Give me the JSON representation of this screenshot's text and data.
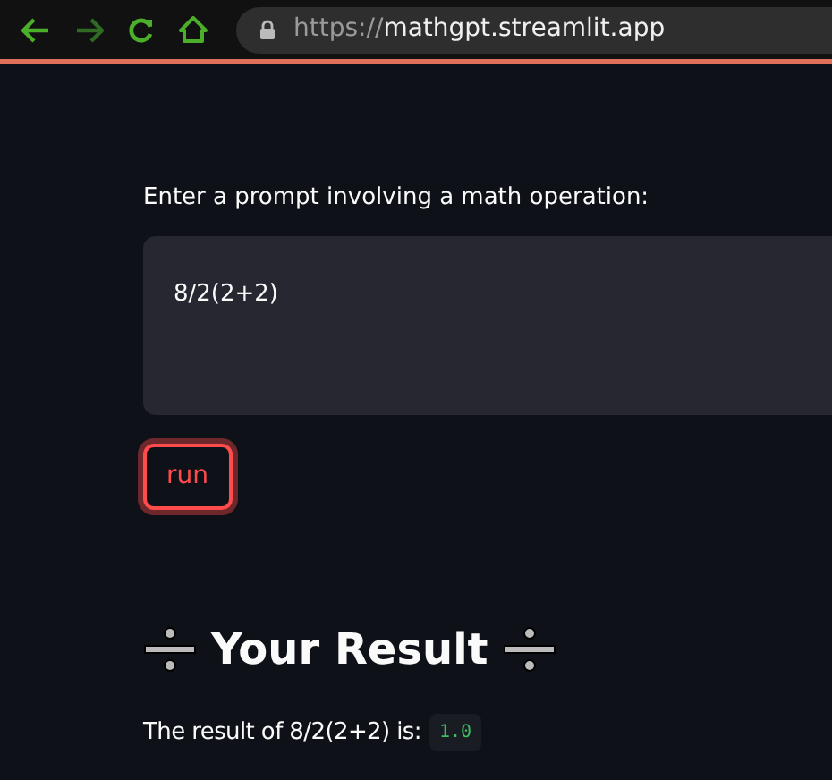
{
  "browser": {
    "url_scheme": "https://",
    "url_host": "mathgpt.streamlit.app"
  },
  "prompt": {
    "label": "Enter a prompt involving a math operation:",
    "value": "8/2(2+2)"
  },
  "run_button": {
    "label": "run",
    "focused": true
  },
  "result": {
    "heading": "Your Result",
    "sentence": "The result of 8/2(2+2) is:",
    "value": "1.0"
  }
}
